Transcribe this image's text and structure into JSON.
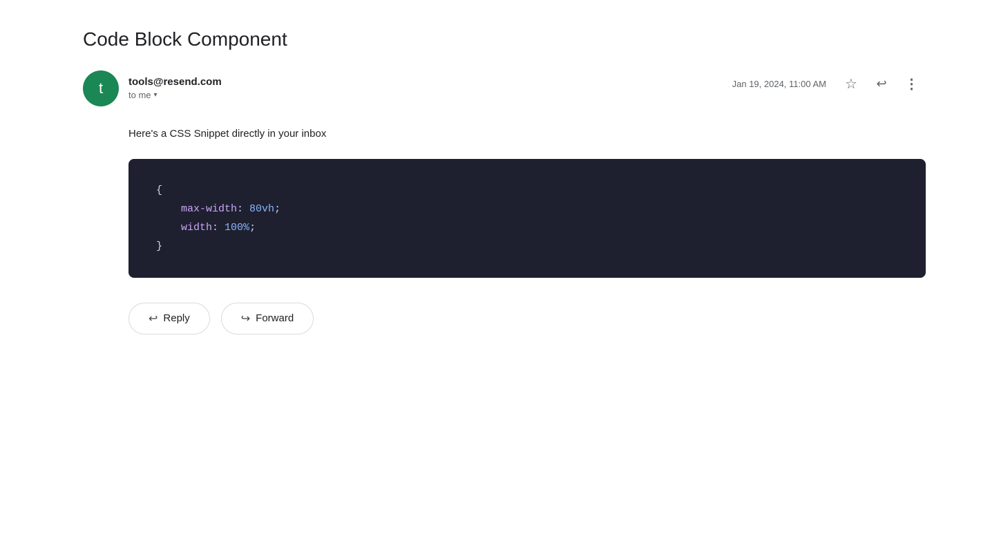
{
  "email": {
    "subject": "Code Block Component",
    "sender": {
      "address": "tools@resend.com",
      "avatar_letter": "t",
      "avatar_color": "#1a8754",
      "to_label": "to me"
    },
    "date": "Jan 19, 2024, 11:00 AM",
    "body_text": "Here's a CSS Snippet directly in your inbox",
    "code_block": {
      "line1": "{",
      "line2_prop": "max-width",
      "line2_value": "80vh",
      "line3_prop": "width",
      "line3_value": "100%",
      "line4": "}"
    }
  },
  "actions": {
    "reply_label": "Reply",
    "forward_label": "Forward"
  },
  "header_actions": {
    "star_label": "Star",
    "reply_label": "Reply",
    "more_label": "More"
  }
}
